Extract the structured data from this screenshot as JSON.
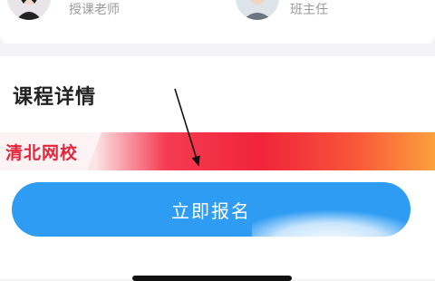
{
  "teachers": [
    {
      "role": "授课老师",
      "avatar_icon": "female-teacher-avatar"
    },
    {
      "role": "班主任",
      "avatar_icon": "male-teacher-avatar"
    }
  ],
  "course": {
    "section_title": "课程详情",
    "banner_brand": "清北网校",
    "signup_label": "立即报名"
  },
  "colors": {
    "accent_blue": "#2f9cf4",
    "banner_red": "#f0243a",
    "banner_orange": "#fca13c"
  }
}
